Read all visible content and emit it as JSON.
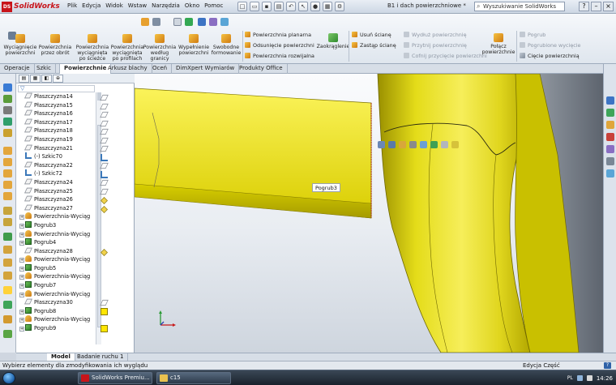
{
  "app": {
    "name": "SolidWorks",
    "logo_text": "DS",
    "document_title": "B1 i dach powierzchniowe *"
  },
  "menu": [
    "Plik",
    "Edycja",
    "Widok",
    "Wstaw",
    "Narzędzia",
    "Okno",
    "Pomoc"
  ],
  "search": {
    "placeholder": "Wyszukiwanie SolidWorks"
  },
  "command_manager": {
    "large_buttons": [
      {
        "label": "Wyciągnięcie powierzchni"
      },
      {
        "label": "Powierzchnia przez obrót"
      },
      {
        "label": "Powierzchnia wyciągnięta po ścieżce"
      },
      {
        "label": "Powierzchnia wyciągnięta po profilach"
      },
      {
        "label": "Powierzchnia według granicy"
      },
      {
        "label": "Wypełnienie powierzchni"
      },
      {
        "label": "Swobodne formowanie"
      }
    ],
    "group1": [
      "Powierzchnia planarna",
      "Odsunięcie powierzchni",
      "Powierzchnia rozwijalna"
    ],
    "zaokraglenie": "Zaokrąglenie",
    "group2": [
      "Usuń ścianę",
      "Zastąp ścianę"
    ],
    "group3_disabled": [
      "Wydłuż powierzchnię",
      "Przytnij powierzchnię",
      "Cofnij przycięcie powierzchni"
    ],
    "polacz": "Połącz powierzchnie",
    "group4": [
      {
        "label": "Pogrub",
        "disabled": true
      },
      {
        "label": "Pogrubione wycięcie",
        "disabled": true
      },
      {
        "label": "Cięcie powierzchnią",
        "disabled": false
      }
    ]
  },
  "tabs": [
    "Operacje",
    "Szkic",
    "Powierzchnie",
    "Arkusz blachy",
    "Oceń",
    "DimXpert Wymiarów",
    "Produkty Office"
  ],
  "active_tab": "Powierzchnie",
  "feature_tree": [
    {
      "label": "Płaszczyzna14",
      "icon": "plane-icon"
    },
    {
      "label": "Płaszczyzna15",
      "icon": "plane-icon"
    },
    {
      "label": "Płaszczyzna16",
      "icon": "plane-icon"
    },
    {
      "label": "Płaszczyzna17",
      "icon": "plane-icon"
    },
    {
      "label": "Płaszczyzna18",
      "icon": "plane-icon"
    },
    {
      "label": "Płaszczyzna19",
      "icon": "plane-icon"
    },
    {
      "label": "Płaszczyzna21",
      "icon": "plane-icon"
    },
    {
      "label": "(-) Szkic70",
      "icon": "sketch-icon"
    },
    {
      "label": "Płaszczyzna22",
      "icon": "plane-icon"
    },
    {
      "label": "(-) Szkic72",
      "icon": "sketch-icon"
    },
    {
      "label": "Płaszczyzna24",
      "icon": "plane-icon"
    },
    {
      "label": "Płaszczyzna25",
      "icon": "plane-icon"
    },
    {
      "label": "Płaszczyzna26",
      "icon": "plane-icon"
    },
    {
      "label": "Płaszczyzna27",
      "icon": "plane-icon"
    },
    {
      "label": "Powierzchnia-Wyciąg",
      "icon": "surface-icon",
      "expandable": true
    },
    {
      "label": "Pogrub3",
      "icon": "thicken-icon",
      "expandable": true
    },
    {
      "label": "Powierzchnia-Wyciąg",
      "icon": "surface-icon",
      "expandable": true
    },
    {
      "label": "Pogrub4",
      "icon": "thicken-icon",
      "expandable": true
    },
    {
      "label": "Płaszczyzna28",
      "icon": "plane-icon"
    },
    {
      "label": "Powierzchnia-Wyciąg",
      "icon": "surface-icon",
      "expandable": true
    },
    {
      "label": "Pogrub5",
      "icon": "thicken-icon",
      "expandable": true
    },
    {
      "label": "Powierzchnia-Wyciąg",
      "icon": "surface-icon",
      "expandable": true
    },
    {
      "label": "Pogrub7",
      "icon": "thicken-icon",
      "expandable": true
    },
    {
      "label": "Powierzchnia-Wyciąg",
      "icon": "surface-icon",
      "expandable": true
    },
    {
      "label": "Płaszczyzna30",
      "icon": "plane-icon"
    },
    {
      "label": "Pogrub8",
      "icon": "thicken-icon",
      "expandable": true
    },
    {
      "label": "Powierzchnia-Wyciąg",
      "icon": "surface-icon",
      "expandable": true
    },
    {
      "label": "Pogrub9",
      "icon": "thicken-icon",
      "expandable": true
    }
  ],
  "viewport": {
    "tooltip": "Pogrub3"
  },
  "bottom_tabs": [
    "Model",
    "Badanie ruchu 1"
  ],
  "status": {
    "message": "Wybierz elementy dla zmodyfikowania ich wyglądu",
    "mode": "Edycja Część",
    "help": "?"
  },
  "taskbar": {
    "apps": [
      {
        "label": "SolidWorks Premiu...",
        "color": "#c8141a"
      },
      {
        "label": "c15",
        "color": "#e9c14f"
      }
    ],
    "lang": "PL",
    "time": "14:26"
  },
  "colors": {
    "model_yellow": "#e8e200",
    "accent": "#c8141a"
  }
}
